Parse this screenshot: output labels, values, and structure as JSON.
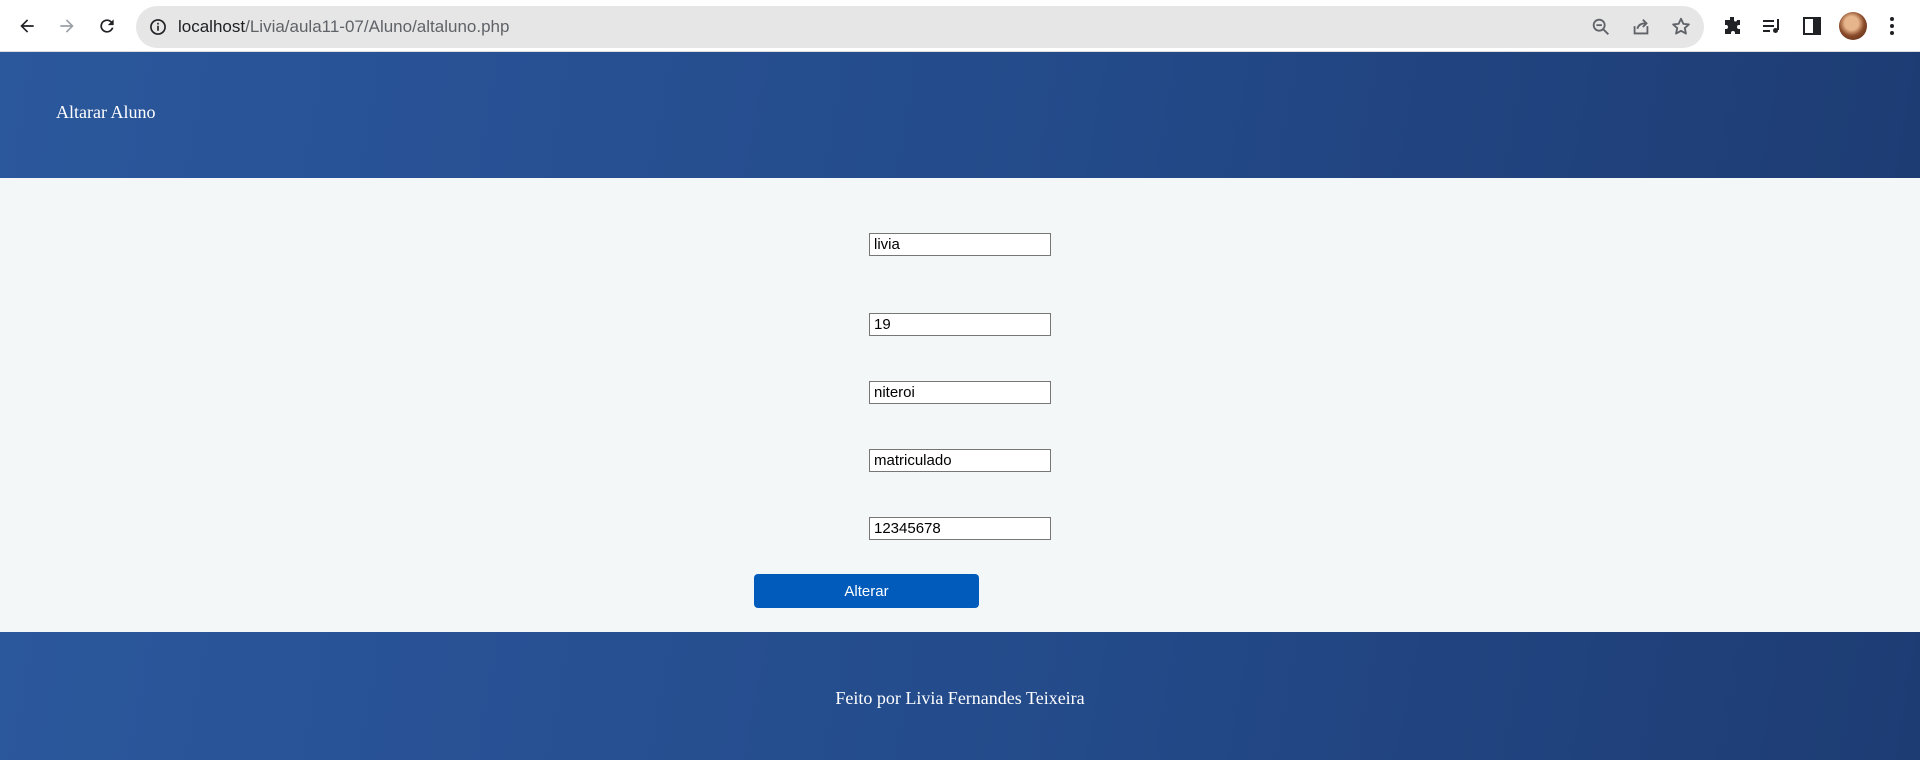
{
  "browser": {
    "url_host": "localhost",
    "url_path": "/Livia/aula11-07/Aluno/altaluno.php"
  },
  "page": {
    "header_title": "Altarar Aluno",
    "fields": [
      {
        "value": "livia"
      },
      {
        "value": "19"
      },
      {
        "value": "niteroi"
      },
      {
        "value": "matriculado"
      },
      {
        "value": "12345678"
      }
    ],
    "submit_label": "Alterar",
    "footer_text": "Feito por Livia Fernandes Teixeira"
  },
  "colors": {
    "header_bg": "#2b579c",
    "button_bg": "#005bbb",
    "content_bg": "#f4f7f8"
  }
}
